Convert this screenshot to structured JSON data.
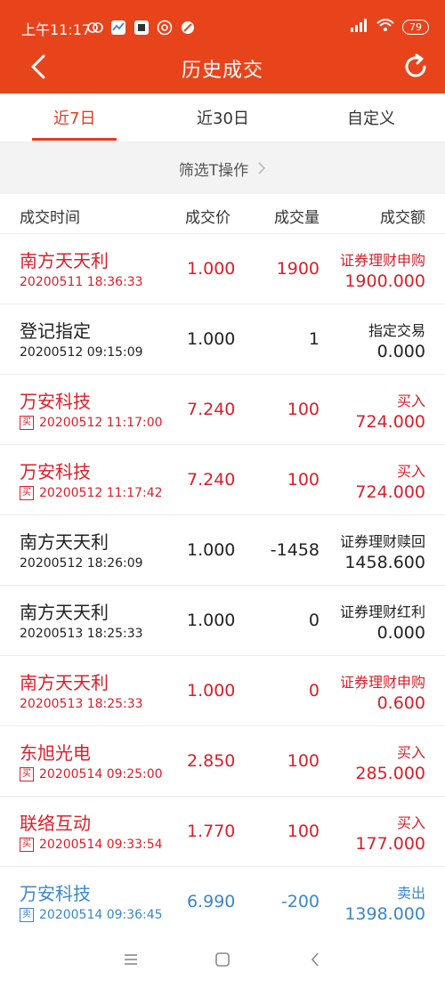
{
  "status": {
    "time": "上午11:17",
    "battery": "79",
    "icons": [
      "app-icon-red",
      "app-icon-blue",
      "app-icon-black",
      "podcast-icon",
      "block-icon"
    ],
    "right_icons": [
      "signal-icon",
      "wifi-icon",
      "battery-icon"
    ]
  },
  "header": {
    "title": "历史成交",
    "back_icon": "back-arrow-icon",
    "refresh_icon": "refresh-icon"
  },
  "tabs": [
    {
      "label": "近7日",
      "active": true
    },
    {
      "label": "近30日",
      "active": false
    },
    {
      "label": "自定义",
      "active": false
    }
  ],
  "filter": {
    "label": "筛选T操作"
  },
  "columns": [
    "成交时间",
    "成交价",
    "成交量",
    "成交额"
  ],
  "colors": {
    "accent": "#e8441c",
    "red": "#d8202a",
    "blue": "#3d86c6"
  },
  "rows": [
    {
      "name": "南方天天利",
      "time": "20200511 18:36:33",
      "tag": "",
      "price": "1.000",
      "qty": "1900",
      "op": "证券理财申购",
      "amount": "1900.000",
      "color": "red"
    },
    {
      "name": "登记指定",
      "time": "20200512 09:15:09",
      "tag": "",
      "price": "1.000",
      "qty": "1",
      "op": "指定交易",
      "amount": "0.000",
      "color": "black"
    },
    {
      "name": "万安科技",
      "time": "20200512 11:17:00",
      "tag": "买",
      "price": "7.240",
      "qty": "100",
      "op": "买入",
      "amount": "724.000",
      "color": "red"
    },
    {
      "name": "万安科技",
      "time": "20200512 11:17:42",
      "tag": "买",
      "price": "7.240",
      "qty": "100",
      "op": "买入",
      "amount": "724.000",
      "color": "red"
    },
    {
      "name": "南方天天利",
      "time": "20200512 18:26:09",
      "tag": "",
      "price": "1.000",
      "qty": "-1458",
      "op": "证券理财赎回",
      "amount": "1458.600",
      "color": "black"
    },
    {
      "name": "南方天天利",
      "time": "20200513 18:25:33",
      "tag": "",
      "price": "1.000",
      "qty": "0",
      "op": "证券理财红利",
      "amount": "0.000",
      "color": "black"
    },
    {
      "name": "南方天天利",
      "time": "20200513 18:25:33",
      "tag": "",
      "price": "1.000",
      "qty": "0",
      "op": "证券理财申购",
      "amount": "0.600",
      "color": "red"
    },
    {
      "name": "东旭光电",
      "time": "20200514 09:25:00",
      "tag": "买",
      "price": "2.850",
      "qty": "100",
      "op": "买入",
      "amount": "285.000",
      "color": "red"
    },
    {
      "name": "联络互动",
      "time": "20200514 09:33:54",
      "tag": "买",
      "price": "1.770",
      "qty": "100",
      "op": "买入",
      "amount": "177.000",
      "color": "red"
    },
    {
      "name": "万安科技",
      "time": "20200514 09:36:45",
      "tag": "卖",
      "price": "6.990",
      "qty": "-200",
      "op": "卖出",
      "amount": "1398.000",
      "color": "blue"
    }
  ],
  "navbar": {
    "icons": [
      "menu-icon",
      "home-icon",
      "back-icon"
    ]
  }
}
